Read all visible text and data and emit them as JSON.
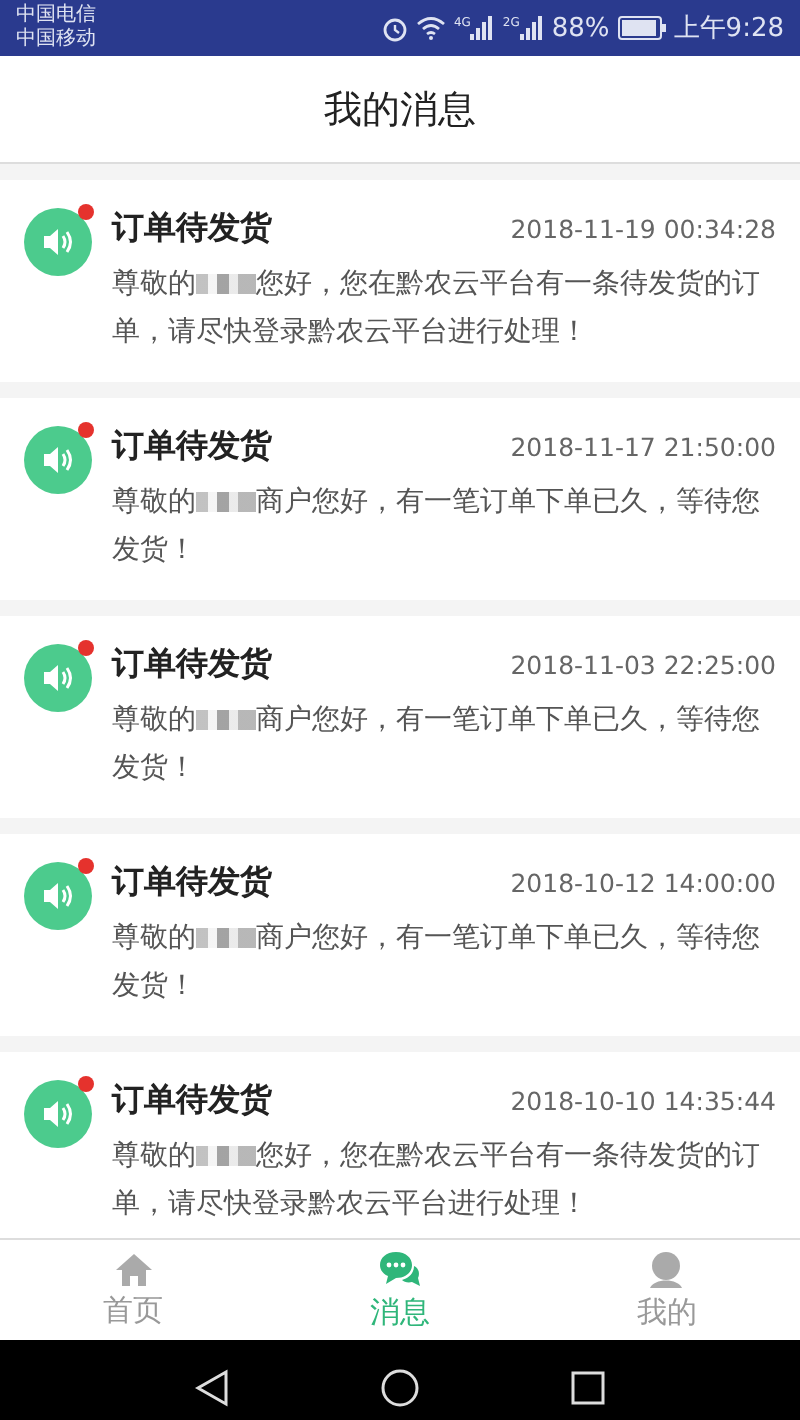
{
  "status_bar": {
    "carriers": [
      "中国电信",
      "中国移动"
    ],
    "network_labels": [
      "4G",
      "2G"
    ],
    "battery": "88%",
    "time": "上午9:28"
  },
  "header": {
    "title": "我的消息"
  },
  "messages": [
    {
      "title": "订单待发货",
      "time": "2018-11-19 00:34:28",
      "unread": true,
      "body_start": "尊敬的",
      "body_end": "您好，您在黔农云平台有一条待发货的订单，请尽快登录黔农云平台进行处理！"
    },
    {
      "title": "订单待发货",
      "time": "2018-11-17 21:50:00",
      "unread": true,
      "body_start": "尊敬的",
      "body_end": "商户您好，有一笔订单下单已久，等待您发货！"
    },
    {
      "title": "订单待发货",
      "time": "2018-11-03 22:25:00",
      "unread": true,
      "body_start": "尊敬的",
      "body_end": "商户您好，有一笔订单下单已久，等待您发货！"
    },
    {
      "title": "订单待发货",
      "time": "2018-10-12 14:00:00",
      "unread": true,
      "body_start": "尊敬的",
      "body_end": "商户您好，有一笔订单下单已久，等待您发货！"
    },
    {
      "title": "订单待发货",
      "time": "2018-10-10 14:35:44",
      "unread": true,
      "body_start": "尊敬的",
      "body_end": "您好，您在黔农云平台有一条待发货的订单，请尽快登录黔农云平台进行处理！"
    }
  ],
  "tabs": [
    {
      "label": "首页",
      "selected": false
    },
    {
      "label": "消息",
      "selected": true
    },
    {
      "label": "我的",
      "selected": false
    }
  ]
}
